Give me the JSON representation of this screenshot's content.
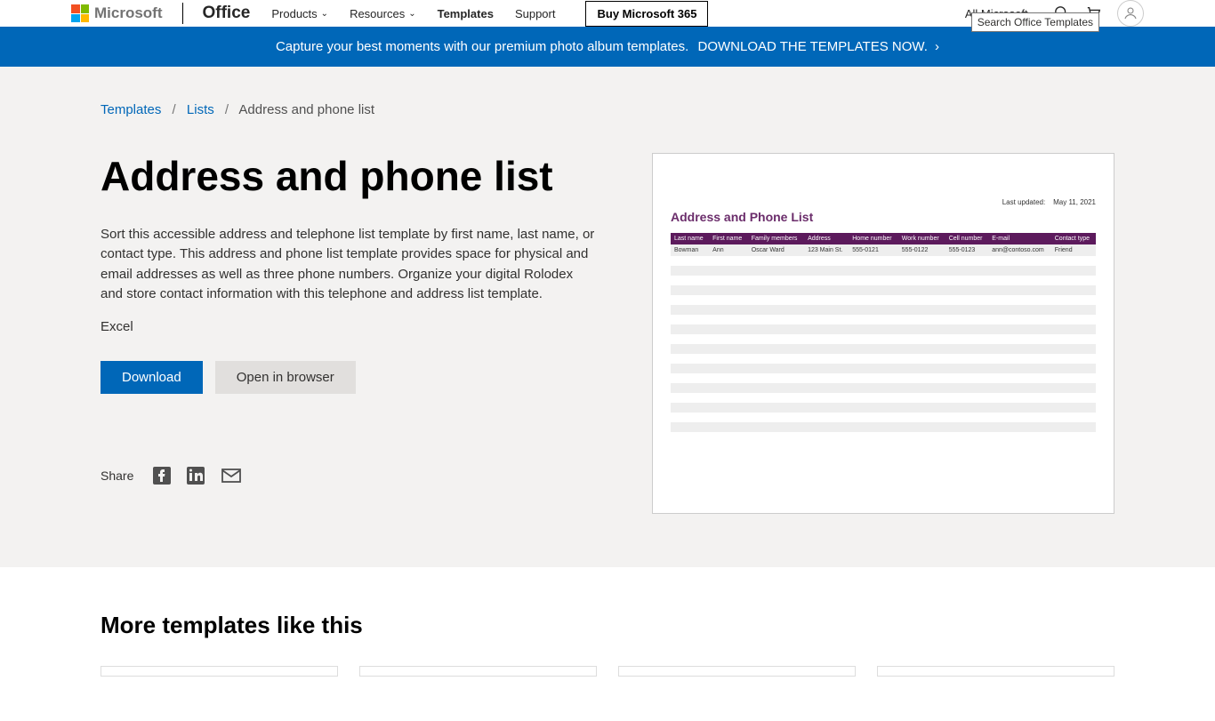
{
  "header": {
    "brand": "Microsoft",
    "office": "Office",
    "nav": {
      "products": "Products",
      "resources": "Resources",
      "templates": "Templates",
      "support": "Support",
      "buy": "Buy Microsoft 365"
    },
    "all_microsoft": "All Microsoft",
    "search_tooltip": "Search Office Templates"
  },
  "banner": {
    "text": "Capture your best moments with our premium photo album templates.",
    "cta": "DOWNLOAD THE TEMPLATES NOW."
  },
  "breadcrumb": {
    "templates": "Templates",
    "lists": "Lists",
    "current": "Address and phone list"
  },
  "page": {
    "title": "Address and phone list",
    "description": "Sort this accessible address and telephone list template by first name, last name, or contact type. This address and phone list template provides space for physical and email addresses as well as three phone numbers. Organize your digital Rolodex and store contact information with this telephone and address list template.",
    "app": "Excel",
    "download": "Download",
    "open": "Open in browser",
    "share": "Share"
  },
  "preview": {
    "last_updated_label": "Last updated:",
    "last_updated_value": "May 11, 2021",
    "title": "Address and Phone List",
    "headers": [
      "Last name",
      "First name",
      "Family members",
      "Address",
      "Home number",
      "Work number",
      "Cell number",
      "E-mail",
      "Contact type"
    ],
    "row": [
      "Bowman",
      "Ann",
      "Oscar Ward",
      "123 Main St.",
      "555-0121",
      "555-0122",
      "555-0123",
      "ann@contoso.com",
      "Friend"
    ]
  },
  "more": {
    "heading": "More templates like this"
  }
}
